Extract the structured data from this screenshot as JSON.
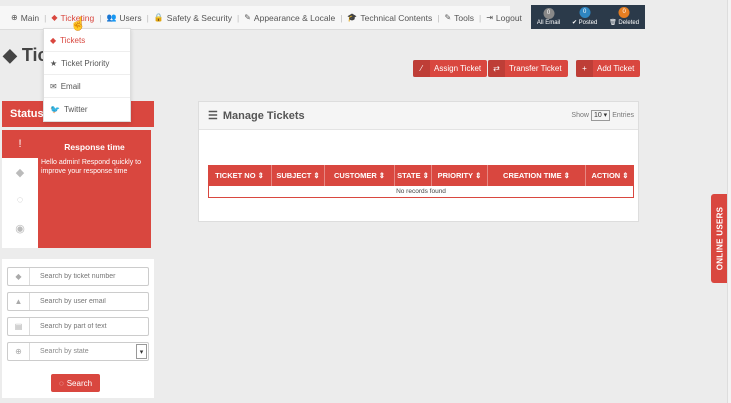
{
  "nav": {
    "items": [
      {
        "label": "Main",
        "icon": "⊕"
      },
      {
        "label": "Ticketing",
        "icon": "◆"
      },
      {
        "label": "Users",
        "icon": "👥"
      },
      {
        "label": "Safety & Security",
        "icon": "🔒"
      },
      {
        "label": "Appearance & Locale",
        "icon": "✎"
      },
      {
        "label": "Technical Contents",
        "icon": "🎓"
      },
      {
        "label": "Tools",
        "icon": "✎"
      },
      {
        "label": "Logout",
        "icon": "⇥"
      }
    ]
  },
  "dropdown": {
    "items": [
      {
        "label": "Tickets",
        "icon": "◆"
      },
      {
        "label": "Ticket Priority",
        "icon": "★"
      },
      {
        "label": "Email",
        "icon": "✉"
      },
      {
        "label": "Twitter",
        "icon": "🐦"
      }
    ]
  },
  "counters": [
    {
      "label": "All Email",
      "count": "0",
      "color": "#888888"
    },
    {
      "label": "✔ Posted",
      "count": "0",
      "color": "#2e86c1"
    },
    {
      "label": "🗑 Deleted",
      "count": "0",
      "color": "#e67e22"
    }
  ],
  "page": {
    "title": "Tic"
  },
  "actions": {
    "assign": "Assign Ticket",
    "transfer": "Transfer Ticket",
    "add": "Add Ticket"
  },
  "status": {
    "title": "Status",
    "response_title": "Response time",
    "response_text": "Hello admin! Respond quickly to improve your response time"
  },
  "search": {
    "ticket_placeholder": "Search by ticket number",
    "email_placeholder": "Search by user email",
    "text_placeholder": "Search by part of text",
    "state_placeholder": "Search by state",
    "button": "Search"
  },
  "manage": {
    "title": "Manage Tickets",
    "show_label": "Show",
    "show_value": "10",
    "entries_label": "Entries",
    "columns": [
      "TICKET NO",
      "SUBJECT",
      "CUSTOMER",
      "STATE",
      "PRIORITY",
      "CREATION TIME",
      "ACTION"
    ],
    "empty_text": "No records found"
  },
  "online_users": "ONLINE USERS",
  "colors": {
    "accent": "#d9473f",
    "counter_bar": "#2b3a4a"
  }
}
